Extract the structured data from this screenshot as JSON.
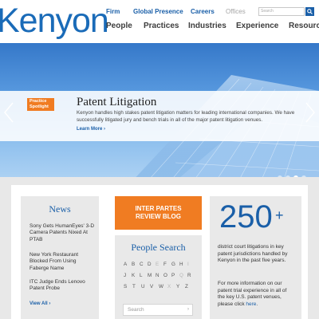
{
  "header": {
    "logo": "Kenyon",
    "utility": [
      "Firm",
      "Global Presence",
      "Careers",
      "Offices"
    ],
    "search_placeholder": "Search",
    "nav": [
      "People",
      "Practices",
      "Industries",
      "Experience",
      "Resources"
    ]
  },
  "hero": {
    "badge_line1": "Practice",
    "badge_line2": "Spotlight",
    "title": "Patent Litigation",
    "text": "Kenyon handles high stakes patent litigation matters for leading international companies. We have successfully litigated jury and bench trials in all of the major patent litigation venues.",
    "more": "Learn More ›",
    "slides": 4,
    "active_slide": 3
  },
  "news": {
    "title": "News",
    "items": [
      "Sony Gets HumanEyes' 3-D Camera Patents Nixed At PTAB",
      "New York Restaurant Blocked From Using Faberge Name",
      "ITC Judge Ends Lenovo Patent Probe"
    ],
    "view_all": "View All ›"
  },
  "blog": {
    "line1": "INTER PARTES",
    "line2": "REVIEW BLOG"
  },
  "people_search": {
    "title": "People Search",
    "rows": [
      [
        "A",
        "B",
        "C",
        "D",
        "E",
        "F",
        "G",
        "H",
        "I"
      ],
      [
        "J",
        "K",
        "L",
        "M",
        "N",
        "O",
        "P",
        "Q",
        "R"
      ],
      [
        "S",
        "T",
        "U",
        "V",
        "W",
        "X",
        "Y",
        "Z"
      ]
    ],
    "dim_letters": [
      "E",
      "I",
      "Q",
      "X"
    ],
    "placeholder": "Search",
    "chevron": "›"
  },
  "stat": {
    "number": "250",
    "plus": "+",
    "text": "district court litigations in key patent jurisdictions handled by Kenyon in the past five years.",
    "text2_prefix": "For more information on our patent trial experience in all of the key U.S. patent venues, please click ",
    "text2_link": "here",
    "text2_suffix": "."
  },
  "colors": {
    "brand_blue": "#1a5fa8",
    "accent_orange": "#f07c22",
    "panel_gray": "#e9e9e9"
  }
}
